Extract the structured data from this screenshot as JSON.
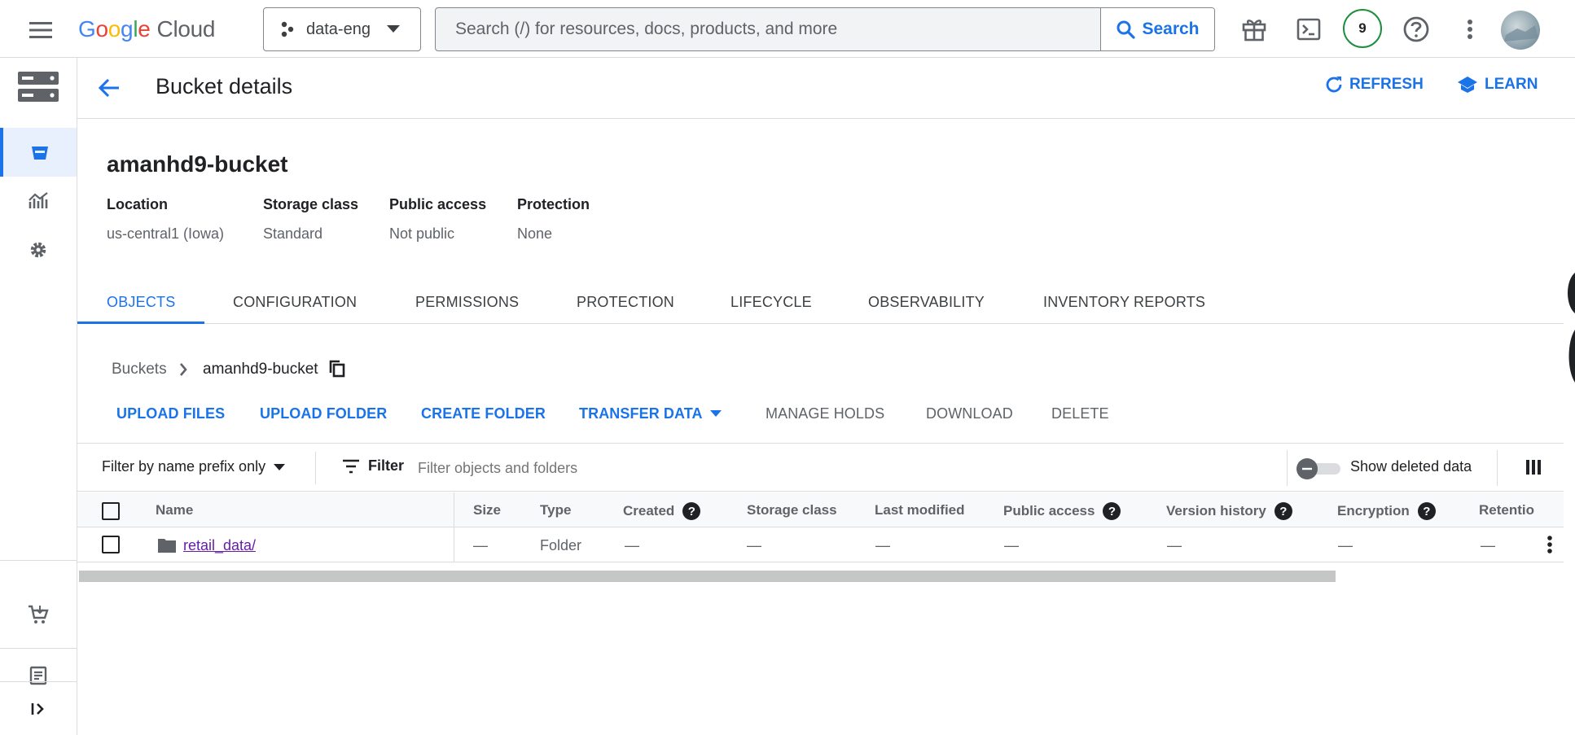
{
  "topbar": {
    "logo_google": [
      "G",
      "o",
      "o",
      "g",
      "l",
      "e"
    ],
    "logo_cloud": "Cloud",
    "project_name": "data-eng",
    "search_placeholder": "Search (/) for resources, docs, products, and more",
    "search_button": "Search",
    "notification_count": "9",
    "icons": [
      "menu-icon",
      "gift-icon",
      "terminal-icon",
      "help-icon",
      "more-vert-icon"
    ]
  },
  "header": {
    "title": "Bucket details",
    "refresh_label": "REFRESH",
    "learn_label": "LEARN"
  },
  "bucket": {
    "name": "amanhd9-bucket",
    "info": [
      {
        "label": "Location",
        "value": "us-central1 (Iowa)"
      },
      {
        "label": "Storage class",
        "value": "Standard"
      },
      {
        "label": "Public access",
        "value": "Not public"
      },
      {
        "label": "Protection",
        "value": "None"
      }
    ]
  },
  "tabs": [
    "OBJECTS",
    "CONFIGURATION",
    "PERMISSIONS",
    "PROTECTION",
    "LIFECYCLE",
    "OBSERVABILITY",
    "INVENTORY REPORTS"
  ],
  "active_tab": "OBJECTS",
  "breadcrumb": {
    "root": "Buckets",
    "current": "amanhd9-bucket"
  },
  "actions": {
    "upload_files": "UPLOAD FILES",
    "upload_folder": "UPLOAD FOLDER",
    "create_folder": "CREATE FOLDER",
    "transfer_data": "TRANSFER DATA",
    "manage_holds": "MANAGE HOLDS",
    "download": "DOWNLOAD",
    "delete": "DELETE"
  },
  "filter": {
    "mode": "Filter by name prefix only",
    "filter_label": "Filter",
    "placeholder": "Filter objects and folders",
    "show_deleted_label": "Show deleted data"
  },
  "table": {
    "columns": {
      "name": "Name",
      "size": "Size",
      "type": "Type",
      "created": "Created",
      "storage_class": "Storage class",
      "last_modified": "Last modified",
      "public_access": "Public access",
      "version_history": "Version history",
      "encryption": "Encryption",
      "retention": "Retentio"
    },
    "rows": [
      {
        "name": "retail_data/",
        "size": "—",
        "type": "Folder",
        "created": "—",
        "storage_class": "—",
        "last_modified": "—",
        "public_access": "—",
        "version_history": "—",
        "encryption": "—",
        "retention": "—"
      }
    ]
  },
  "colors": {
    "accent": "#1a73e8",
    "badge_ring": "#1e8e3e",
    "link_visited": "#681da8"
  }
}
